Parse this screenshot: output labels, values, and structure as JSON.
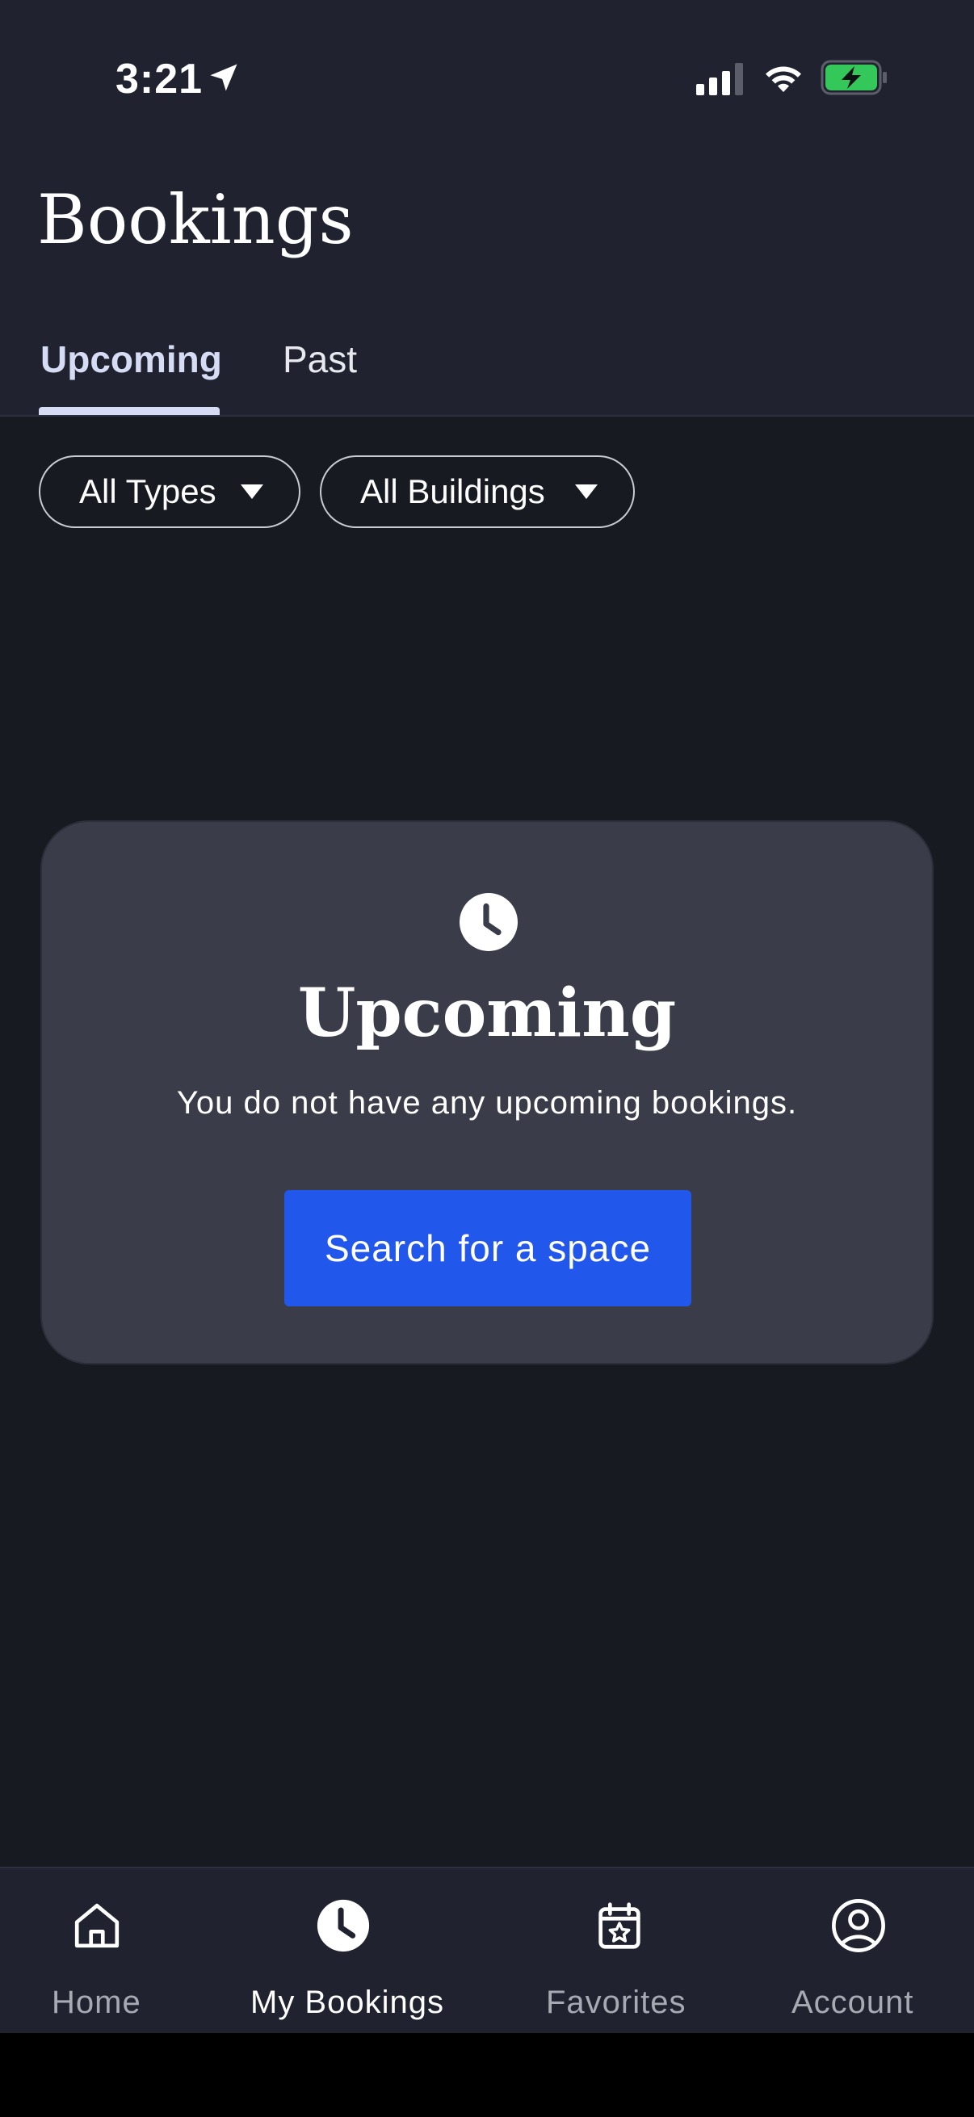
{
  "status_bar": {
    "time": "3:21",
    "icons": [
      "location-arrow-icon",
      "signal-icon",
      "wifi-icon",
      "battery-charging-icon"
    ]
  },
  "header": {
    "title": "Bookings"
  },
  "tabs": [
    {
      "label": "Upcoming",
      "active": true
    },
    {
      "label": "Past",
      "active": false
    }
  ],
  "filters": [
    {
      "label": "All Types",
      "icon": "caret-down-icon"
    },
    {
      "label": "All Buildings",
      "icon": "caret-down-icon"
    }
  ],
  "empty_state": {
    "icon": "clock-icon",
    "title": "Upcoming",
    "message": "You do not have any upcoming bookings.",
    "button_label": "Search for a space"
  },
  "bottom_nav": [
    {
      "label": "Home",
      "icon": "home-icon",
      "active": false
    },
    {
      "label": "My Bookings",
      "icon": "clock-icon",
      "active": true
    },
    {
      "label": "Favorites",
      "icon": "calendar-star-icon",
      "active": false
    },
    {
      "label": "Account",
      "icon": "user-circle-icon",
      "active": false
    }
  ],
  "colors": {
    "background": "#181a22",
    "header": "#20232f",
    "card": "#3a3d49",
    "primary_button": "#2257ec",
    "tab_active": "#d6dcf4",
    "battery": "#34c759"
  }
}
